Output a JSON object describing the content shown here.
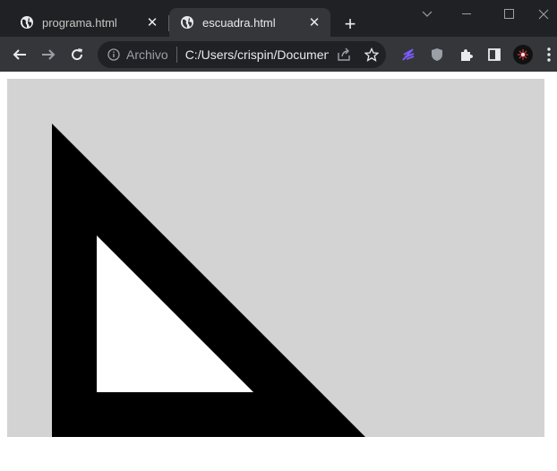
{
  "tabs": [
    {
      "title": "programa.html",
      "active": false,
      "icon": "globe-icon"
    },
    {
      "title": "escuadra.html",
      "active": true,
      "icon": "globe-icon"
    }
  ],
  "omnibox": {
    "security_label": "Archivo",
    "url": "C:/Users/crispin/Documents/escuadra.html"
  },
  "colors": {
    "tabstrip": "#202124",
    "toolbar": "#35363a",
    "canvas_background": "#d3d3d3",
    "square_outer": "#000000",
    "square_inner": "#ffffff"
  },
  "canvas_content": {
    "description_shape": "right-triangle set square (escuadra)"
  }
}
